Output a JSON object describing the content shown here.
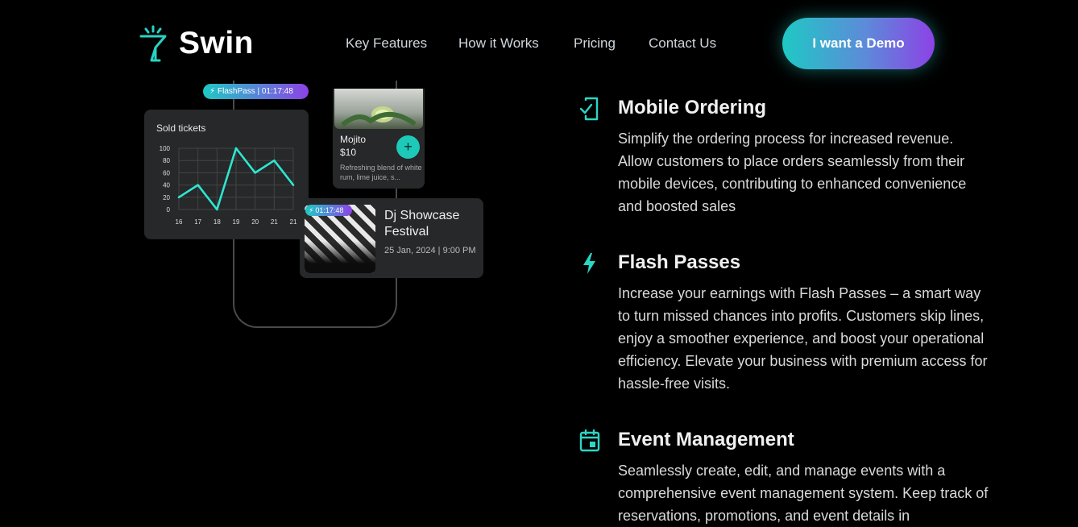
{
  "brand": {
    "name": "Swin"
  },
  "nav": {
    "items": [
      "Key Features",
      "How it Works",
      "Pricing",
      "Contact Us"
    ],
    "cta_label": "I want a Demo"
  },
  "colors": {
    "accent": "#1ec9c5",
    "accent_purple": "#8c42e6",
    "card": "#262829",
    "background": "#000000"
  },
  "mockup": {
    "flash_pill": "FlashPass | 01:17:48",
    "drink": {
      "name": "Mojito",
      "price": "$10",
      "description": "Refreshing blend of white rum, lime juice, s...",
      "add_icon": "plus-icon"
    },
    "event": {
      "timer": "01:17:48",
      "title": "Dj Showcase Festival",
      "date": "25 Jan, 2024 | 9:00 PM"
    }
  },
  "chart_data": {
    "type": "line",
    "title": "Sold tickets",
    "categories": [
      "16",
      "17",
      "18",
      "19",
      "20",
      "21",
      "21"
    ],
    "values": [
      20,
      40,
      0,
      100,
      60,
      80,
      40
    ],
    "yticks": [
      100,
      80,
      60,
      40,
      20,
      0
    ],
    "ylim": [
      0,
      100
    ],
    "grid": true,
    "color": "#2ee6d0"
  },
  "features": [
    {
      "icon": "mobile-check-icon",
      "title": "Mobile Ordering",
      "description": "Simplify the ordering process for increased revenue. Allow customers to place orders seamlessly from their mobile devices, contributing to enhanced convenience and boosted sales"
    },
    {
      "icon": "lightning-icon",
      "title": "Flash Passes",
      "description": "Increase your earnings with Flash Passes – a smart way to turn missed chances into profits. Customers skip lines, enjoy a smoother experience, and boost your operational efficiency. Elevate your business with premium access for hassle-free visits."
    },
    {
      "icon": "calendar-icon",
      "title": "Event Management",
      "description": "Seamlessly create, edit, and manage events with a comprehensive event management system. Keep track of reservations, promotions, and event details in"
    }
  ]
}
